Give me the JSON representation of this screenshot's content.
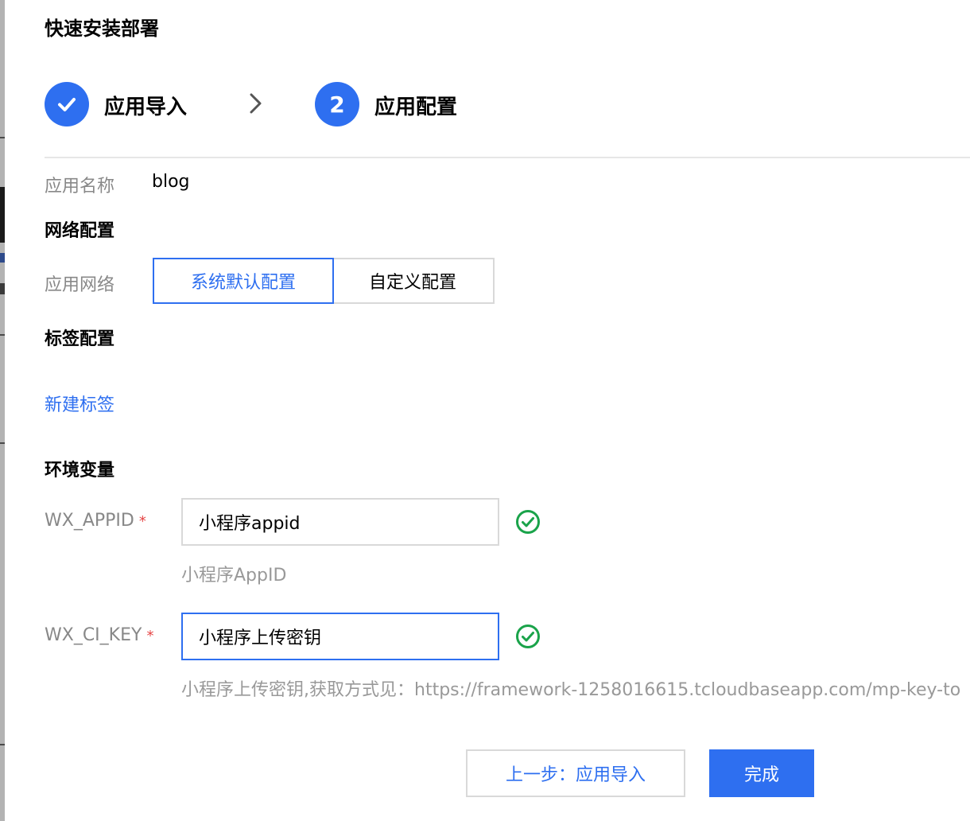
{
  "dialog": {
    "title": "快速安装部署"
  },
  "steps": [
    {
      "state": "done",
      "label": "应用导入"
    },
    {
      "number": "2",
      "state": "active",
      "label": "应用配置"
    }
  ],
  "app_name": {
    "label": "应用名称",
    "value": "blog"
  },
  "network": {
    "section_title": "网络配置",
    "label": "应用网络",
    "options": [
      {
        "label": "系统默认配置",
        "selected": true
      },
      {
        "label": "自定义配置",
        "selected": false
      }
    ]
  },
  "tags": {
    "section_title": "标签配置",
    "new_tag_link": "新建标签"
  },
  "env": {
    "section_title": "环境变量",
    "required_mark": "*",
    "fields": [
      {
        "key": "WX_APPID",
        "value": "小程序appid",
        "help": "小程序AppID",
        "valid": true
      },
      {
        "key": "WX_CI_KEY",
        "value": "小程序上传密钥",
        "help": "小程序上传密钥,获取方式见：https://framework-1258016615.tcloudbaseapp.com/mp-key-to",
        "valid": true
      }
    ]
  },
  "footer": {
    "prev_label": "上一步：应用导入",
    "done_label": "完成"
  },
  "colors": {
    "primary": "#2e6ff0",
    "success": "#1aa34a",
    "required": "#e54545",
    "muted": "#888888"
  },
  "icons": [
    "checkmark-icon",
    "chevron-right-icon",
    "check-circle-icon"
  ]
}
